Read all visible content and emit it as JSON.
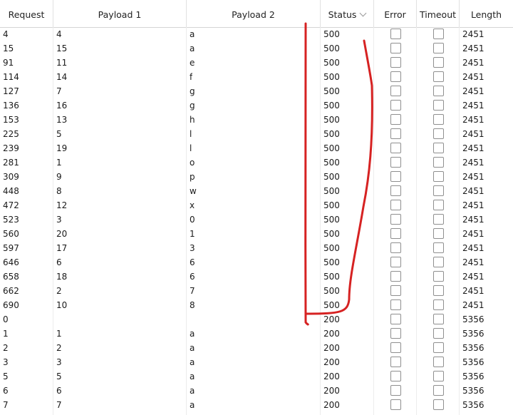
{
  "columns": [
    "Request",
    "Payload 1",
    "Payload 2",
    "Status",
    "Error",
    "Timeout",
    "Length"
  ],
  "sort_icon": "chevron-down-icon",
  "rows": [
    {
      "request": "4",
      "payload1": "4",
      "payload2": "a",
      "status": "500",
      "length": "2451"
    },
    {
      "request": "15",
      "payload1": "15",
      "payload2": "a",
      "status": "500",
      "length": "2451"
    },
    {
      "request": "91",
      "payload1": "11",
      "payload2": "e",
      "status": "500",
      "length": "2451"
    },
    {
      "request": "114",
      "payload1": "14",
      "payload2": "f",
      "status": "500",
      "length": "2451"
    },
    {
      "request": "127",
      "payload1": "7",
      "payload2": "g",
      "status": "500",
      "length": "2451"
    },
    {
      "request": "136",
      "payload1": "16",
      "payload2": "g",
      "status": "500",
      "length": "2451"
    },
    {
      "request": "153",
      "payload1": "13",
      "payload2": "h",
      "status": "500",
      "length": "2451"
    },
    {
      "request": "225",
      "payload1": "5",
      "payload2": "l",
      "status": "500",
      "length": "2451"
    },
    {
      "request": "239",
      "payload1": "19",
      "payload2": "l",
      "status": "500",
      "length": "2451"
    },
    {
      "request": "281",
      "payload1": "1",
      "payload2": "o",
      "status": "500",
      "length": "2451"
    },
    {
      "request": "309",
      "payload1": "9",
      "payload2": "p",
      "status": "500",
      "length": "2451"
    },
    {
      "request": "448",
      "payload1": "8",
      "payload2": "w",
      "status": "500",
      "length": "2451"
    },
    {
      "request": "472",
      "payload1": "12",
      "payload2": "x",
      "status": "500",
      "length": "2451"
    },
    {
      "request": "523",
      "payload1": "3",
      "payload2": "0",
      "status": "500",
      "length": "2451"
    },
    {
      "request": "560",
      "payload1": "20",
      "payload2": "1",
      "status": "500",
      "length": "2451"
    },
    {
      "request": "597",
      "payload1": "17",
      "payload2": "3",
      "status": "500",
      "length": "2451"
    },
    {
      "request": "646",
      "payload1": "6",
      "payload2": "6",
      "status": "500",
      "length": "2451"
    },
    {
      "request": "658",
      "payload1": "18",
      "payload2": "6",
      "status": "500",
      "length": "2451"
    },
    {
      "request": "662",
      "payload1": "2",
      "payload2": "7",
      "status": "500",
      "length": "2451"
    },
    {
      "request": "690",
      "payload1": "10",
      "payload2": "8",
      "status": "500",
      "length": "2451"
    },
    {
      "request": "0",
      "payload1": "",
      "payload2": "",
      "status": "200",
      "length": "5356"
    },
    {
      "request": "1",
      "payload1": "1",
      "payload2": "a",
      "status": "200",
      "length": "5356"
    },
    {
      "request": "2",
      "payload1": "2",
      "payload2": "a",
      "status": "200",
      "length": "5356"
    },
    {
      "request": "3",
      "payload1": "3",
      "payload2": "a",
      "status": "200",
      "length": "5356"
    },
    {
      "request": "5",
      "payload1": "5",
      "payload2": "a",
      "status": "200",
      "length": "5356"
    },
    {
      "request": "6",
      "payload1": "6",
      "payload2": "a",
      "status": "200",
      "length": "5356"
    },
    {
      "request": "7",
      "payload1": "7",
      "payload2": "a",
      "status": "200",
      "length": "5356"
    }
  ],
  "annotation_color": "#d62222"
}
